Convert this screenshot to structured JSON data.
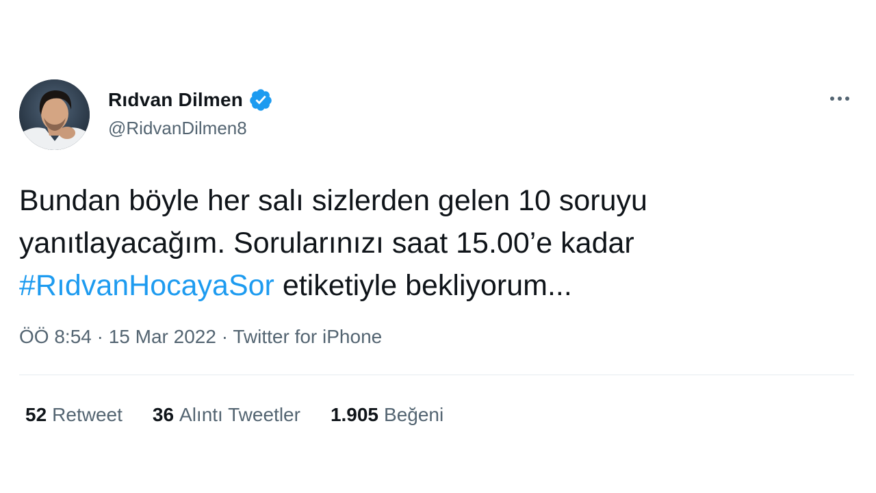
{
  "tweet": {
    "author": {
      "display_name": "Rıdvan Dilmen",
      "handle": "@RidvanDilmen8",
      "verified": true,
      "avatar_icon": "profile-photo"
    },
    "more_icon": "ellipsis-icon",
    "text": {
      "line1": "Bundan böyle her salı sizlerden gelen 10 soruyu",
      "line2": "yanıtlayacağım. Sorularınızı saat 15.00’e kadar",
      "hashtag": "#RıdvanHocayaSor",
      "line3_rest": " etiketiyle bekliyorum..."
    },
    "meta": {
      "time": "ÖÖ 8:54",
      "separator": " · ",
      "date": "15 Mar 2022",
      "source": "Twitter for iPhone"
    },
    "stats": [
      {
        "count": "52",
        "label": "Retweet"
      },
      {
        "count": "36",
        "label": "Alıntı Tweetler"
      },
      {
        "count": "1.905",
        "label": "Beğeni"
      }
    ]
  },
  "colors": {
    "accent": "#1d9bf0",
    "secondary_text": "#536471",
    "primary_text": "#0f1419",
    "divider": "#e6ecf0"
  }
}
